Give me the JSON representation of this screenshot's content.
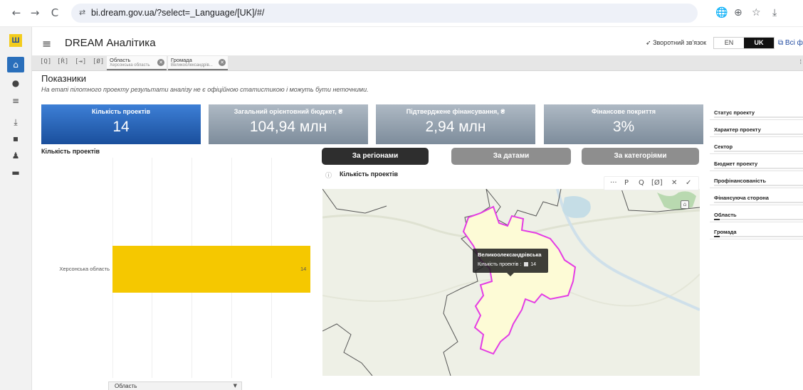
{
  "browser": {
    "back": "←",
    "forward": "→",
    "reload": "C",
    "site_icon": "⇄",
    "url": "bi.dream.gov.ua/?select=_Language/[UK]/#/",
    "translate": "🌐",
    "zoom": "⊕",
    "star": "☆",
    "download": "⤓"
  },
  "rail": {
    "logo": "Ш",
    "items": [
      {
        "icon": "home-icon",
        "glyph": "⌂"
      },
      {
        "icon": "database-icon",
        "glyph": "●"
      },
      {
        "icon": "list-icon",
        "glyph": "≡"
      },
      {
        "icon": "download-icon",
        "glyph": "⤓"
      },
      {
        "icon": "document-icon",
        "glyph": "▪"
      },
      {
        "icon": "users-icon",
        "glyph": "♟"
      },
      {
        "icon": "stack-icon",
        "glyph": "▬"
      }
    ]
  },
  "header": {
    "menu": "≡",
    "title": "DREAM Аналітика",
    "feedback": "Зворотний зв'язок",
    "lang_en": "EN",
    "lang_uk": "UK",
    "all_filters": "Всі фі"
  },
  "selections": {
    "tools": [
      "[Q]",
      "[Ŕ]",
      "[⇥]",
      "[Ø]"
    ],
    "chips": [
      {
        "title": "Область",
        "value": "Херсонська область"
      },
      {
        "title": "Громада",
        "value": "Великоолександрів..."
      }
    ],
    "more": "⁞"
  },
  "main": {
    "title": "Показники",
    "subtitle": "На етапі пілотного проекту результати аналізу не є офіційною статистикою і можуть бути неточними."
  },
  "kpis": [
    {
      "label": "Кількість проектів",
      "value": "14"
    },
    {
      "label": "Загальний орієнтовний бюджет, ₴",
      "value": "104,94 млн"
    },
    {
      "label": "Підтверджене фінансування, ₴",
      "value": "2,94 млн"
    },
    {
      "label": "Фінансове покриття",
      "value": "3%"
    }
  ],
  "bar_chart": {
    "title": "Кількість проектів",
    "dropdown": "Область",
    "dropdown_arrow": "▼"
  },
  "chart_data": {
    "type": "bar",
    "orientation": "horizontal",
    "title": "Кількість проектів",
    "categories": [
      "Херсонська область"
    ],
    "values": [
      14
    ],
    "xlim": [
      0,
      14
    ],
    "color": "#f5c800"
  },
  "tabs": [
    {
      "label": "За регіонами",
      "active": true
    },
    {
      "label": "За датами",
      "active": false
    },
    {
      "label": "За категоріями",
      "active": false
    }
  ],
  "map": {
    "info": "ⓘ",
    "title": "Кількість проектів",
    "tools": [
      "···",
      "P",
      "Q",
      "[Ø]",
      "✕",
      "✓"
    ],
    "tooltip_name": "Великоолександрівська",
    "tooltip_label": "Кількість проектів :",
    "tooltip_value": "14",
    "highlight_color": "#e43ce4",
    "region_fill": "#fdfbd6"
  },
  "filters": [
    {
      "label": "Статус проекту",
      "fill": 0
    },
    {
      "label": "Характер проекту",
      "fill": 0
    },
    {
      "label": "Сектор",
      "fill": 0
    },
    {
      "label": "Бюджет проекту",
      "fill": 0
    },
    {
      "label": "Профінансованість",
      "fill": 0
    },
    {
      "label": "Фінансуюча сторона",
      "fill": 0
    },
    {
      "label": "Область",
      "fill": 0.06
    },
    {
      "label": "Громада",
      "fill": 0.06
    }
  ]
}
